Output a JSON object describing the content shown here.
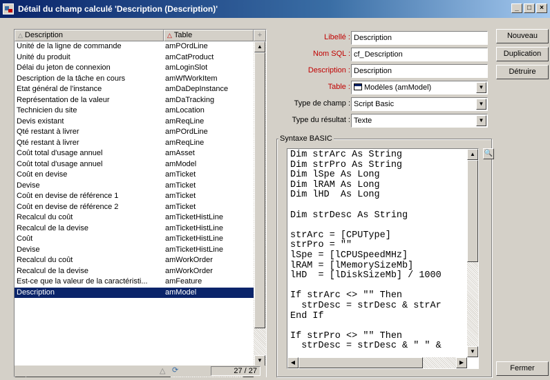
{
  "window": {
    "title": "Détail du champ calculé 'Description (Description)'",
    "controls": [
      "_",
      "□",
      "×"
    ]
  },
  "list": {
    "headers": {
      "name": "Description",
      "table": "Table"
    },
    "rows": [
      {
        "name": "Unité de la ligne de commande",
        "table": "amPOrdLine"
      },
      {
        "name": "Unité du produit",
        "table": "amCatProduct"
      },
      {
        "name": "Délai du jeton de connexion",
        "table": "amLoginSlot"
      },
      {
        "name": "Description de la tâche en cours",
        "table": "amWfWorkItem"
      },
      {
        "name": "Etat général de l'instance",
        "table": "amDaDepInstance"
      },
      {
        "name": "Représentation de la valeur",
        "table": "amDaTracking"
      },
      {
        "name": "Technicien du site",
        "table": "amLocation"
      },
      {
        "name": "Devis existant",
        "table": "amReqLine"
      },
      {
        "name": "Qté restant à livrer",
        "table": "amPOrdLine"
      },
      {
        "name": "Qté restant à livrer",
        "table": "amReqLine"
      },
      {
        "name": "Coût total d'usage annuel",
        "table": "amAsset"
      },
      {
        "name": "Coût total d'usage annuel",
        "table": "amModel"
      },
      {
        "name": "Coût en devise",
        "table": "amTicket"
      },
      {
        "name": "Devise",
        "table": "amTicket"
      },
      {
        "name": "Coût en devise de référence 1",
        "table": "amTicket"
      },
      {
        "name": "Coût en devise de référence 2",
        "table": "amTicket"
      },
      {
        "name": "Recalcul du coût",
        "table": "amTicketHistLine"
      },
      {
        "name": "Recalcul de la devise",
        "table": "amTicketHistLine"
      },
      {
        "name": "Coût",
        "table": "amTicketHistLine"
      },
      {
        "name": "Devise",
        "table": "amTicketHistLine"
      },
      {
        "name": "Recalcul du coût",
        "table": "amWorkOrder"
      },
      {
        "name": "Recalcul de la devise",
        "table": "amWorkOrder"
      },
      {
        "name": "Est-ce que la valeur de la caractéristi...",
        "table": "amFeature"
      },
      {
        "name": "Description",
        "table": "amModel"
      }
    ],
    "selected_index": 23,
    "counter": "27 / 27"
  },
  "form": {
    "libelle": {
      "label": "Libellé :",
      "value": "Description"
    },
    "nom_sql": {
      "label": "Nom SQL :",
      "prefix": "cf_",
      "value": "Description"
    },
    "description": {
      "label": "Description :",
      "value": "Description"
    },
    "table": {
      "label": "Table :",
      "value": "Modèles (amModel)"
    },
    "type_champ": {
      "label": "Type de champ :",
      "value": "Script Basic"
    },
    "type_resultat": {
      "label": "Type du résultat :",
      "value": "Texte"
    }
  },
  "syntax": {
    "title": "Syntaxe BASIC",
    "code": "Dim strArc As String\nDim strPro As String\nDim lSpe As Long\nDim lRAM As Long\nDim lHD  As Long\n\nDim strDesc As String\n\nstrArc = [CPUType]\nstrPro = \"\"\nlSpe = [lCPUSpeedMHz]\nlRAM = [lMemorySizeMb]\nlHD  = [lDiskSizeMb] / 1000\n\nIf strArc <> \"\" Then\n  strDesc = strDesc & strAr\nEnd If\n\nIf strPro <> \"\" Then\n  strDesc = strDesc & \" \" &"
  },
  "buttons": {
    "new": "Nouveau",
    "duplicate": "Duplication",
    "delete": "Détruire",
    "close": "Fermer"
  },
  "colors": {
    "title_bar": "#0a246a",
    "selection": "#0a246a",
    "required_label": "#c00000",
    "face": "#d4d0c8"
  }
}
